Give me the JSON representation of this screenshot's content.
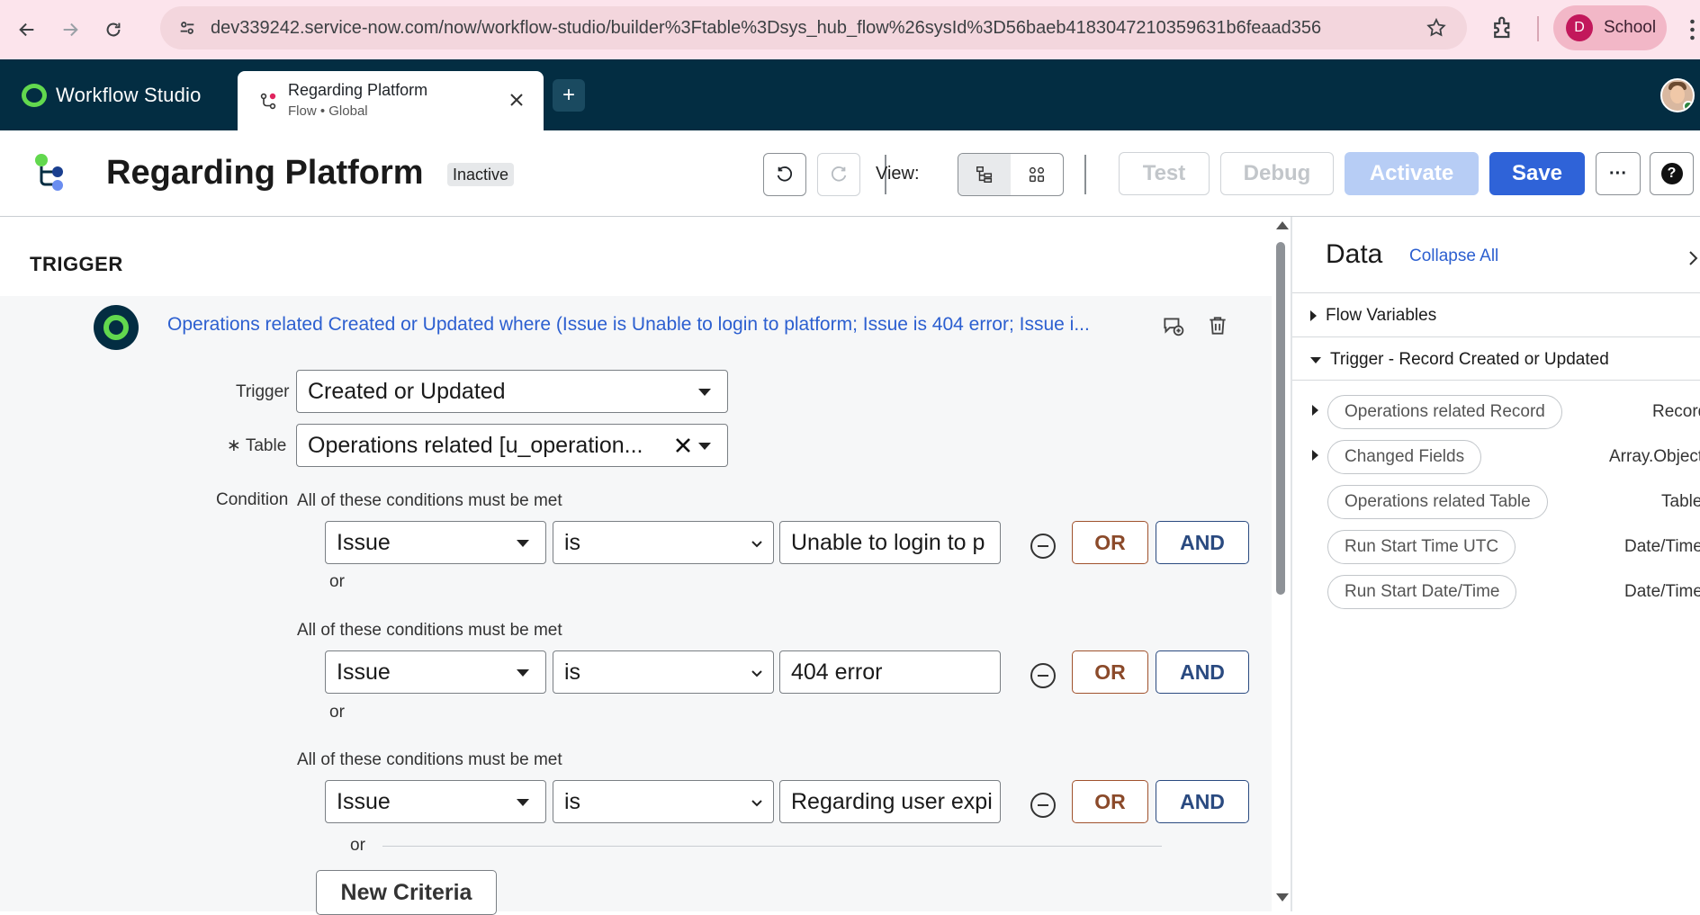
{
  "browser": {
    "url": "dev339242.service-now.com/now/workflow-studio/builder%3Ftable%3Dsys_hub_flow%26sysId%3D56baeb4183047210359631b6feaad356",
    "profile_initial": "D",
    "profile_name": "School"
  },
  "app": {
    "brand": "Workflow Studio",
    "tab": {
      "title": "Regarding Platform",
      "subtitle": "Flow • Global"
    },
    "add_tab": "+"
  },
  "flow": {
    "title": "Regarding Platform",
    "status": "Inactive",
    "view_label": "View:",
    "buttons": {
      "test": "Test",
      "debug": "Debug",
      "activate": "Activate",
      "save": "Save",
      "more": "···",
      "help": "?"
    }
  },
  "trigger": {
    "heading": "TRIGGER",
    "summary": "Operations related Created or Updated where (Issue is Unable to login to platform; Issue is 404 error; Issue i...",
    "trigger_label": "Trigger",
    "trigger_value": "Created or Updated",
    "table_label": "Table",
    "table_required_mark": "∗",
    "table_value": "Operations related [u_operation...",
    "condition_label": "Condition",
    "condition_groups": [
      {
        "caption": "All of these conditions must be met",
        "field": "Issue",
        "operator": "is",
        "value": "Unable to login to p",
        "or_label": "or"
      },
      {
        "caption": "All of these conditions must be met",
        "field": "Issue",
        "operator": "is",
        "value": "404 error",
        "or_label": "or"
      },
      {
        "caption": "All of these conditions must be met",
        "field": "Issue",
        "operator": "is",
        "value": "Regarding user expi",
        "or_label": "or"
      }
    ],
    "or_button": "OR",
    "and_button": "AND",
    "new_criteria": "New Criteria"
  },
  "data_pane": {
    "title": "Data",
    "collapse_all": "Collapse All",
    "sections": [
      {
        "label": "Flow Variables",
        "expanded": false
      },
      {
        "label": "Trigger - Record Created or Updated",
        "expanded": true
      }
    ],
    "pills": [
      {
        "label": "Operations related Record",
        "type": "Record",
        "expandable": true
      },
      {
        "label": "Changed Fields",
        "type": "Array.Object",
        "expandable": true
      },
      {
        "label": "Operations related Table",
        "type": "Table",
        "expandable": false
      },
      {
        "label": "Run Start Time UTC",
        "type": "Date/Time",
        "expandable": false
      },
      {
        "label": "Run Start Date/Time",
        "type": "Date/Time",
        "expandable": false
      }
    ]
  },
  "colors": {
    "browser_bar": "#fce4ec",
    "app_header": "#032d42",
    "brand_green": "#62d84e",
    "save_blue": "#2f63d8",
    "activate_disabled": "#b7cdf5",
    "link_blue": "#2c5fd0",
    "or_brown": "#8b4a2a",
    "and_navy": "#2a4a80"
  }
}
